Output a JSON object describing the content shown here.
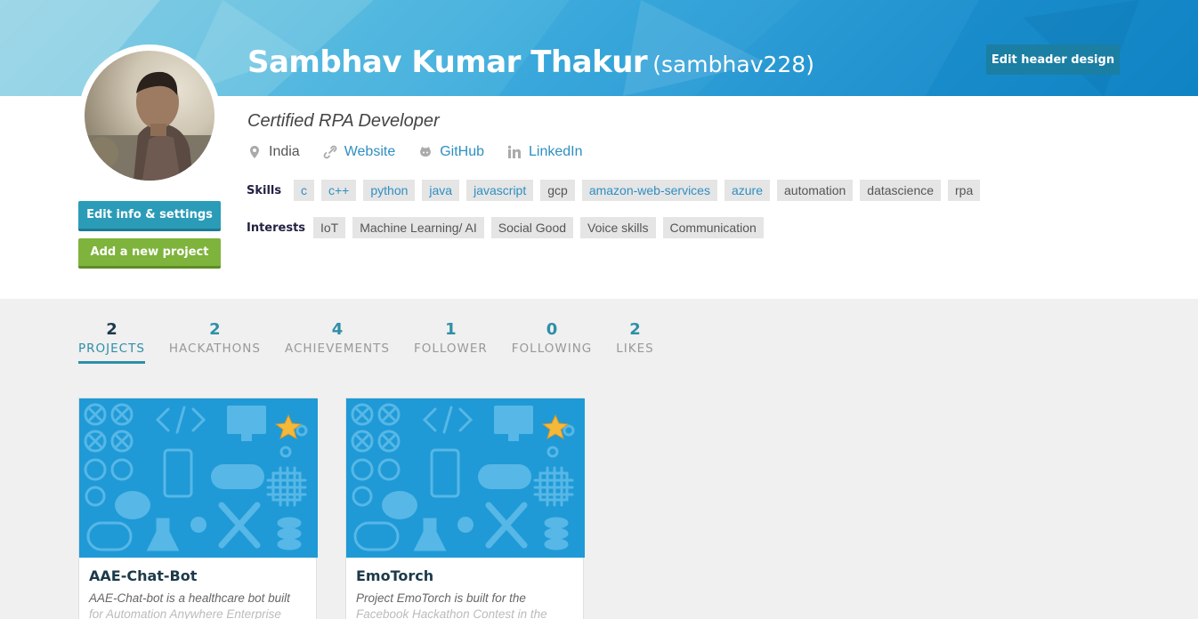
{
  "profile": {
    "name": "Sambhav Kumar Thakur",
    "handle": "(sambhav228)",
    "tagline": "Certified RPA Developer",
    "edit_header_label": "Edit header design",
    "country": "India",
    "links": {
      "website": "Website",
      "github": "GitHub",
      "linkedin": "LinkedIn"
    }
  },
  "skills": {
    "label": "Skills",
    "items": [
      {
        "text": "c",
        "linked": true
      },
      {
        "text": "c++",
        "linked": true
      },
      {
        "text": "python",
        "linked": true
      },
      {
        "text": "java",
        "linked": true
      },
      {
        "text": "javascript",
        "linked": true
      },
      {
        "text": "gcp",
        "linked": false
      },
      {
        "text": "amazon-web-services",
        "linked": true
      },
      {
        "text": "azure",
        "linked": true
      },
      {
        "text": "automation",
        "linked": false
      },
      {
        "text": "datascience",
        "linked": false
      },
      {
        "text": "rpa",
        "linked": false
      }
    ]
  },
  "interests": {
    "label": "Interests",
    "items": [
      "IoT",
      "Machine Learning/ AI",
      "Social Good",
      "Voice skills",
      "Communication"
    ]
  },
  "actions": {
    "edit_info": "Edit info & settings",
    "add_project": "Add a new project"
  },
  "stats": [
    {
      "count": "2",
      "label": "PROJECTS",
      "active": true
    },
    {
      "count": "2",
      "label": "HACKATHONS",
      "active": false
    },
    {
      "count": "4",
      "label": "ACHIEVEMENTS",
      "active": false
    },
    {
      "count": "1",
      "label": "FOLLOWER",
      "active": false
    },
    {
      "count": "0",
      "label": "FOLLOWING",
      "active": false
    },
    {
      "count": "2",
      "label": "LIKES",
      "active": false
    }
  ],
  "projects": [
    {
      "title": "AAE-Chat-Bot",
      "desc_line1": "AAE-Chat-bot is a healthcare bot built",
      "desc_line2": "for Automation Anywhere Enterprise"
    },
    {
      "title": "EmoTorch",
      "desc_line1": "Project EmoTorch is built for the",
      "desc_line2": "Facebook Hackathon Contest in the"
    }
  ],
  "colors": {
    "accent": "#2e8fa8",
    "link": "#2e8fc2",
    "edit_button": "#2b9cb8",
    "add_button": "#7eb33c",
    "header_button": "#1b7ea3",
    "thumbnail": "#1f9ad6",
    "star": "#f5b93a"
  }
}
